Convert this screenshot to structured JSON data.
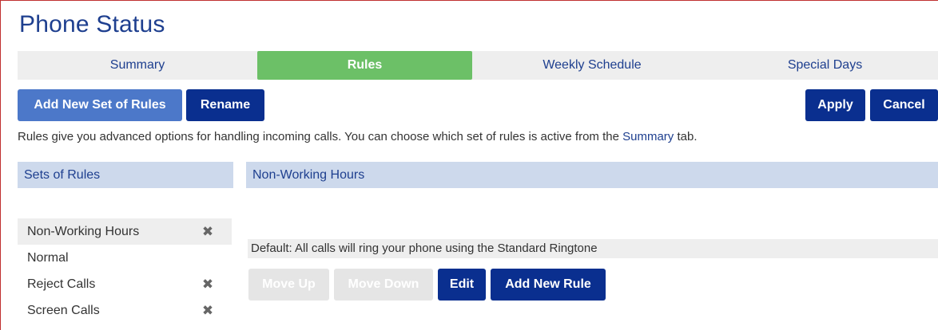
{
  "page": {
    "title": "Phone Status"
  },
  "tabs": [
    {
      "label": "Summary",
      "active": false
    },
    {
      "label": "Rules",
      "active": true
    },
    {
      "label": "Weekly Schedule",
      "active": false
    },
    {
      "label": "Special Days",
      "active": false
    }
  ],
  "toolbar": {
    "add_set_label": "Add New Set of Rules",
    "rename_label": "Rename",
    "apply_label": "Apply",
    "cancel_label": "Cancel"
  },
  "info": {
    "before": "Rules give you advanced options for handling incoming calls. You can choose which set of rules is active from the ",
    "link": "Summary",
    "after": " tab."
  },
  "sets_panel": {
    "header": "Sets of Rules",
    "items": [
      {
        "label": "Non-Working Hours",
        "deletable": true,
        "selected": true
      },
      {
        "label": "Normal",
        "deletable": false,
        "selected": false
      },
      {
        "label": "Reject Calls",
        "deletable": true,
        "selected": false
      },
      {
        "label": "Screen Calls",
        "deletable": true,
        "selected": false
      }
    ],
    "delete_glyph": "✖"
  },
  "rules_panel": {
    "header": "Non-Working Hours",
    "default_text": "Default: All calls will ring your phone using the Standard Ringtone",
    "move_up_label": "Move Up",
    "move_down_label": "Move Down",
    "edit_label": "Edit",
    "add_rule_label": "Add New Rule"
  },
  "colors": {
    "accent_dark": "#0a2f8f",
    "accent_light": "#4c78c9",
    "active_tab": "#6cc067",
    "panel_header": "#cdd9ec",
    "title": "#1e3f8f"
  }
}
